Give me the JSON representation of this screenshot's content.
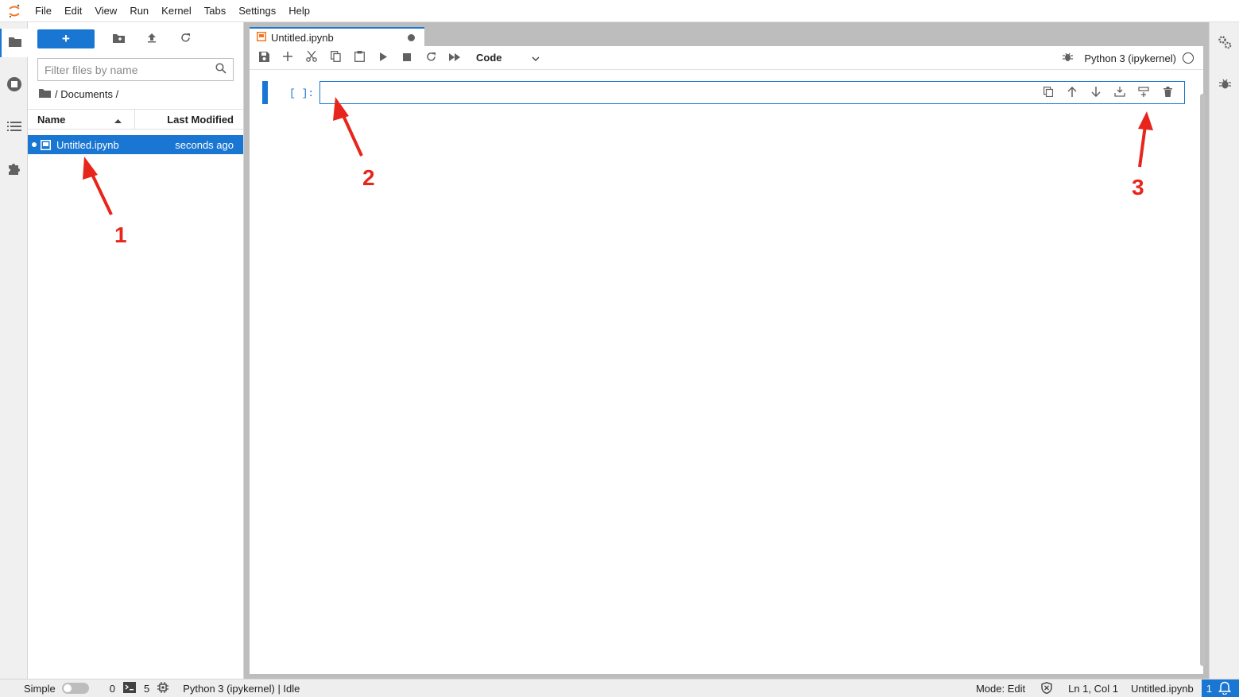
{
  "menubar": {
    "items": [
      "File",
      "Edit",
      "View",
      "Run",
      "Kernel",
      "Tabs",
      "Settings",
      "Help"
    ]
  },
  "left_sidebar": {
    "icons": [
      "folder-icon",
      "running-icon",
      "toc-icon",
      "extension-icon"
    ]
  },
  "filebrowser": {
    "new_label": "+",
    "filter_placeholder": "Filter files by name",
    "breadcrumb": "/ Documents /",
    "columns": {
      "name": "Name",
      "last_modified": "Last Modified"
    },
    "files": [
      {
        "name": "Untitled.ipynb",
        "modified": "seconds ago",
        "selected": true,
        "running": true
      }
    ]
  },
  "tabs": [
    {
      "label": "Untitled.ipynb",
      "dirty": true,
      "active": true
    }
  ],
  "notebook_toolbar": {
    "cell_type": "Code",
    "kernel_name": "Python 3 (ipykernel)"
  },
  "cell": {
    "prompt": "[ ]:",
    "content": ""
  },
  "statusbar": {
    "mode_label": "Simple",
    "terminals_count": "0",
    "kernels_count": "5",
    "kernel_status": "Python 3 (ipykernel) | Idle",
    "mode": "Mode: Edit",
    "cursor": "Ln 1, Col 1",
    "filename": "Untitled.ipynb",
    "notifications": "1"
  },
  "annotations": {
    "labels": [
      "1",
      "2",
      "3"
    ],
    "color": "#e8251c"
  },
  "colors": {
    "accent": "#1976d2",
    "annotation": "#e8251c"
  }
}
